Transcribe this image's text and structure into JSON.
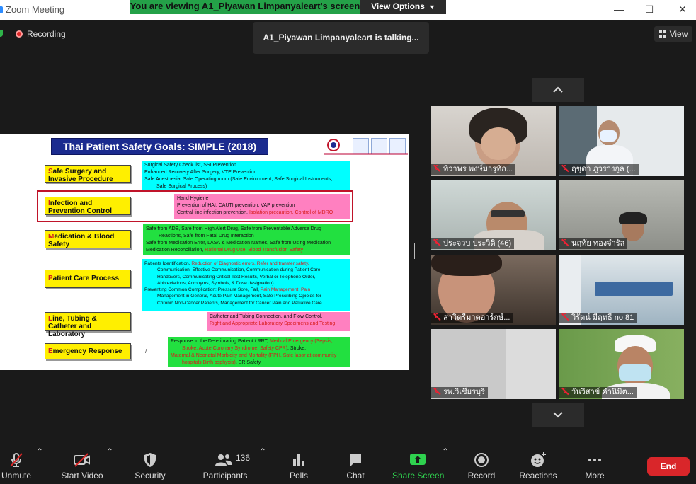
{
  "window": {
    "title": "Zoom Meeting",
    "viewing_banner": "You are viewing A1_Piyawan Limpanyaleart's screen",
    "view_options_label": "View Options",
    "minimize": "—",
    "maximize": "☐",
    "close": "✕"
  },
  "meeting": {
    "recording_label": "Recording",
    "talking_indicator": "A1_Piyawan Limpanyaleart is talking...",
    "view_label": "View"
  },
  "slide": {
    "title": "Thai Patient Safety Goals: SIMPLE (2018)",
    "goals": [
      {
        "label_first": "S",
        "label_rest": "afe Surgery and Invasive Procedure",
        "desc_color": "cyan",
        "desc_lines": [
          {
            "text": "Surgical Safety Check list, SSI Prevention"
          },
          {
            "text": "Enhanced Recovery After Surgery, VTE Prevention"
          },
          {
            "text": "Safe Anesthesia, Safe Operating room (Safe Environment, Safe Surgical Instruments,"
          },
          {
            "text": "Safe Surgical Process)"
          }
        ]
      },
      {
        "label_first": "I",
        "label_rest": "nfection and Prevention Control",
        "desc_color": "pink",
        "desc_lines": [
          {
            "text": "Hand Hygiene"
          },
          {
            "text": "Prevention of HAI, CAUTI prevention, VAP prevention"
          },
          {
            "text": "Central line infection prevention, ",
            "red": "Isolation precaution, Control of MDRO"
          }
        ]
      },
      {
        "label_first": "M",
        "label_rest": "edication & Blood Safety",
        "desc_color": "green",
        "desc_lines": [
          {
            "text": "Safe from ADE, Safe from High Alert Drug, Safe from Preventable Adverse Drug"
          },
          {
            "text": "Reactions, Safe from Fatal Drug Interaction"
          },
          {
            "text": "Safe from Medication Error, LASA & Medication Names, Safe from Using Medication"
          },
          {
            "text": "Medication Reconciliation, ",
            "red": "Rational Drug Use, Blood Transfusion Safety"
          }
        ]
      },
      {
        "label_first": "P",
        "label_rest": "atient Care Process",
        "desc_color": "cyan",
        "desc_lines": [
          {
            "text": "Patients Identification, ",
            "red": "Reduction of Diagnostic errors, Refer and transfer safety,"
          },
          {
            "text": "Communication: Effective Communication, Communication during Patient Care"
          },
          {
            "text": "Handovers, Communicating Critical Test Results, Verbal or Telephone Order,"
          },
          {
            "text": "Abbreviations, Acronyms, Symbols, & Dose designation)"
          },
          {
            "text": "Preventing Common Complication: Pressure Sore, Fall, ",
            "red": "Pain Management: Pain"
          },
          {
            "text": "Management in General, Acute Pain Management, Safe Prescribing Opioids for"
          },
          {
            "text": "Chronic Non-Cancer Patients, Management for Cancer Pain and Palliative Care"
          }
        ]
      },
      {
        "label_first": "L",
        "label_rest": "ine, Tubing & Catheter and Laboratory",
        "desc_color": "pink",
        "desc_lines": [
          {
            "text": "Catheter and Tubing Connection, and Flow Control,"
          },
          {
            "text": "",
            "red": "Right and Appropriate Laboratory Specimens and Testing"
          }
        ]
      },
      {
        "label_first": "E",
        "label_rest": "mergency Response",
        "desc_color": "green",
        "desc_lines": [
          {
            "text": "Response to the Deteriorating Patient / RRT, ",
            "red": "Medical Emergency (Sepsis,"
          },
          {
            "text": "",
            "red": "Stroke, Acute Coronary Syndrome, Safety CPR)",
            "tail": ", Stroke,"
          },
          {
            "text": "",
            "red": "Maternal & Neonatal Morbidity and Mortality (PPH, Safe labor at community"
          },
          {
            "text": "",
            "red": "hospitals Birth asphyxia)",
            "tail": ", ER Safety"
          }
        ]
      }
    ]
  },
  "participants": [
    {
      "name": "ทิวาพร พงษ์มารุทัก..."
    },
    {
      "name": "ฤชุดา ภูวรางกูล (..."
    },
    {
      "name": "ประจวบ ประวิติ (46)"
    },
    {
      "name": "นฤทัย ทองจำรัส"
    },
    {
      "name": "สาวิตรีมาตอาร์กษ์..."
    },
    {
      "name": "วิรัตน์ มีฤทธิ์ no 81"
    },
    {
      "name": "รพ.วิเชียรบุรี"
    },
    {
      "name": "วันวิสาข์ คำนิมิต..."
    }
  ],
  "toolbar": {
    "unmute": "Unmute",
    "start_video": "Start Video",
    "security": "Security",
    "participants": "Participants",
    "participants_count": "136",
    "polls": "Polls",
    "chat": "Chat",
    "share_screen": "Share Screen",
    "record": "Record",
    "reactions": "Reactions",
    "more": "More",
    "end": "End"
  },
  "colors": {
    "viewing_banner": "#24a148",
    "end_button": "#d9262a",
    "share_screen": "#2fd24f",
    "slide_title_bg": "#1b2b8f"
  }
}
